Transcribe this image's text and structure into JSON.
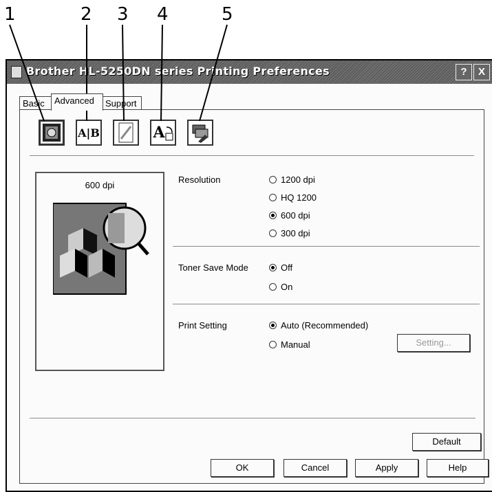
{
  "callouts": [
    "1",
    "2",
    "3",
    "4",
    "5"
  ],
  "window": {
    "title": "Brother HL-5250DN series Printing Preferences",
    "help_button": "?",
    "close_button": "X"
  },
  "tabs": [
    {
      "label": "Basic"
    },
    {
      "label": "Advanced"
    },
    {
      "label": "Support"
    }
  ],
  "toolbar": {
    "buttons": [
      {
        "icon": "print-quality-icon",
        "label": ""
      },
      {
        "icon": "duplex-icon",
        "label": "A|B"
      },
      {
        "icon": "watermark-icon",
        "label": ""
      },
      {
        "icon": "page-setting-icon",
        "label": "A"
      },
      {
        "icon": "device-options-icon",
        "label": ""
      }
    ]
  },
  "preview": {
    "label": "600 dpi"
  },
  "resolution": {
    "label": "Resolution",
    "options": [
      "1200 dpi",
      "HQ 1200",
      "600 dpi",
      "300 dpi"
    ],
    "selected": "600 dpi"
  },
  "toner_save": {
    "label": "Toner Save Mode",
    "options": [
      "Off",
      "On"
    ],
    "selected": "Off"
  },
  "print_setting": {
    "label": "Print Setting",
    "options": [
      "Auto (Recommended)",
      "Manual"
    ],
    "selected": "Auto (Recommended)",
    "setting_button": "Setting..."
  },
  "default_button": "Default",
  "footer": {
    "ok": "OK",
    "cancel": "Cancel",
    "apply": "Apply",
    "help": "Help"
  }
}
